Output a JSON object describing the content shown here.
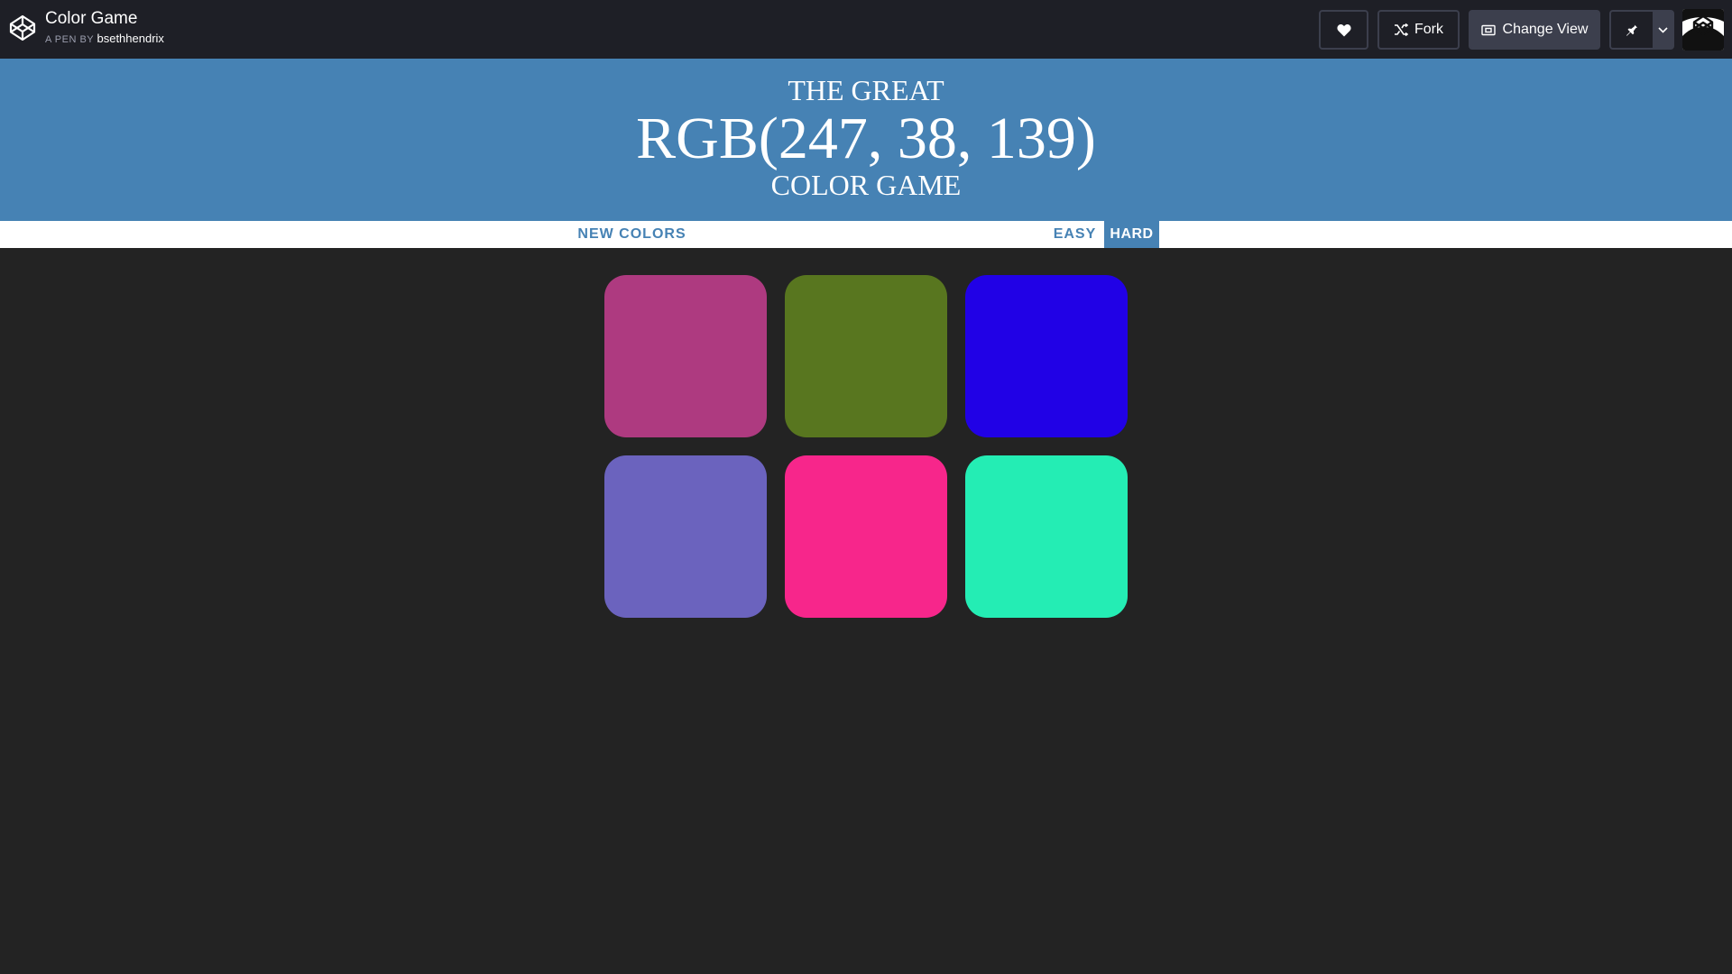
{
  "codepen": {
    "pen_title": "Color Game",
    "byline_prefix": "A PEN BY",
    "author": "bsethhendrix",
    "logo_icon": "codepen-logo-icon",
    "buttons": {
      "heart_icon": "heart-icon",
      "fork_label": "Fork",
      "fork_icon": "fork-icon",
      "change_view_label": "Change View",
      "change_view_icon": "change-view-icon",
      "pin_icon": "pin-icon",
      "dropdown_icon": "chevron-down-icon"
    }
  },
  "game": {
    "header_top": "THE GREAT",
    "target_color": "RGB(247, 38, 139)",
    "header_bottom": "COLOR GAME",
    "header_bg": "#4682b4",
    "body_bg": "#232323"
  },
  "stripe": {
    "new_colors_label": "NEW COLORS",
    "message": "",
    "easy_label": "EASY",
    "hard_label": "HARD",
    "selected_mode": "HARD"
  },
  "squares": [
    {
      "color": "#ae3a80"
    },
    {
      "color": "#58761f"
    },
    {
      "color": "#2101e6"
    },
    {
      "color": "#6b63be"
    },
    {
      "color": "#f7268b"
    },
    {
      "color": "#24edb4"
    }
  ]
}
